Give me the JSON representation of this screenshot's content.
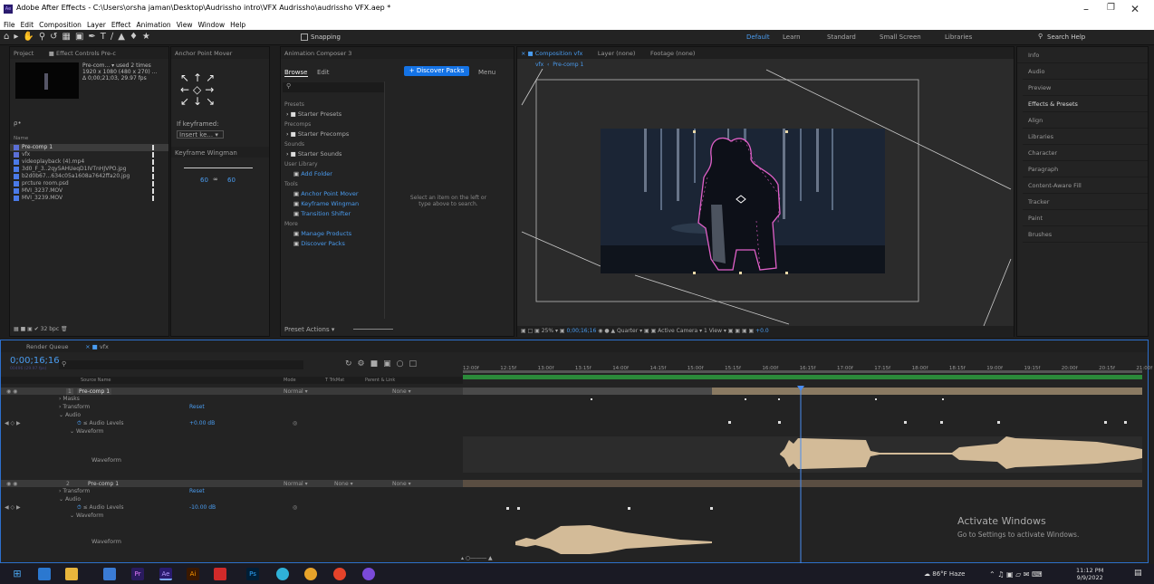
{
  "app": {
    "title": "Adobe After Effects - C:\\Users\\orsha jaman\\Desktop\\Audrissho intro\\VFX Audrissho\\audrissho VFX.aep *",
    "menus": [
      "File",
      "Edit",
      "Composition",
      "Layer",
      "Effect",
      "Animation",
      "View",
      "Window",
      "Help"
    ]
  },
  "toolbar": {
    "snapping": "Snapping",
    "workspaces": [
      "Default",
      "Learn",
      "Standard",
      "Small Screen",
      "Libraries"
    ],
    "search": "Search Help"
  },
  "project": {
    "tabs": [
      "Project",
      "Effect Controls Pre-c"
    ],
    "item_name": "Pre-com... ▾ used 2 times",
    "item_info": "1920 x 1080 (480 x 270) ...",
    "item_dur": "Δ 0;00;21;03, 29.97 fps",
    "search_ph": "ρ•",
    "col_name": "Name",
    "files": [
      "Pre-comp 1",
      "vfx",
      "videoplayback (4).mp4",
      "3d0_F_3..2qy5AHUeqD1IVTnHJVPO.jpg",
      "b2d0b67...634c05a1608a7642ffa20.jpg",
      "prcture room.psd",
      "MVI_3237.MOV",
      "MVI_3239.MOV"
    ],
    "bpc": "32 bpc"
  },
  "anchor": {
    "title": "Anchor Point Mover",
    "if_kf": "If keyframed:",
    "insert": "Insert ke...",
    "kw_title": "Keyframe Wingman",
    "kw_l": "60",
    "kw_r": "60"
  },
  "composer": {
    "title": "Animation Composer 3",
    "browse": "Browse",
    "edit": "Edit",
    "discover": "+ Discover Packs",
    "menu": "Menu",
    "presets": "Presets",
    "starter_presets": "Starter Presets",
    "precomps": "Precomps",
    "starter_precomps": "Starter Precomps",
    "sounds": "Sounds",
    "starter_sounds": "Starter Sounds",
    "user_library": "User Library",
    "add_folder": "Add Folder",
    "tools": "Tools",
    "apm": "Anchor Point Mover",
    "kw": "Keyframe Wingman",
    "ts": "Transition Shifter",
    "more": "More",
    "manage": "Manage Products",
    "discover2": "Discover Packs",
    "hint": "Select an item on the left or type above to search.",
    "preset_actions": "Preset Actions"
  },
  "viewer": {
    "tab_comp": "Composition vfx",
    "tab_layer": "Layer (none)",
    "tab_footage": "Footage (none)",
    "crumb1": "vfx",
    "crumb2": "Pre-comp 1",
    "zoom": "25%",
    "time": "0;00;16;16",
    "res": "Quarter",
    "camera": "Active Camera",
    "view": "1 View",
    "exposure": "+0.0"
  },
  "right": [
    "Info",
    "Audio",
    "Preview",
    "Effects & Presets",
    "Align",
    "Libraries",
    "Character",
    "Paragraph",
    "Content-Aware Fill",
    "Tracker",
    "Paint",
    "Brushes"
  ],
  "timeline": {
    "tab_rq": "Render Queue",
    "tab_vfx": "vfx",
    "timecode": "0;00;16;16",
    "fps": "00496 (29.97 fps)",
    "ruler": [
      "12:00f",
      "12:15f",
      "13:00f",
      "13:15f",
      "14:00f",
      "14:15f",
      "15:00f",
      "15:15f",
      "16:00f",
      "16:15f",
      "17:00f",
      "17:15f",
      "18:00f",
      "18:15f",
      "19:00f",
      "19:15f",
      "20:00f",
      "20:15f",
      "21:00f"
    ],
    "cols": {
      "source": "Source Name",
      "mode": "Mode",
      "trkmat": "T TrkMat",
      "parent": "Parent & Link"
    },
    "l1": {
      "num": "1",
      "name": "Pre-comp 1",
      "mode": "Normal",
      "parent": "None"
    },
    "masks": "Masks",
    "transform": "Transform",
    "reset": "Reset",
    "audio": "Audio",
    "audio_levels": "Audio Levels",
    "l1_db": "+0.00 dB",
    "waveform": "Waveform",
    "l2": {
      "num": "2",
      "name": "Pre-comp 1",
      "mode": "Normal",
      "trk": "None",
      "parent": "None"
    },
    "l2_db": "-10.00 dB"
  },
  "activate": {
    "title": "Activate Windows",
    "sub": "Go to Settings to activate Windows."
  },
  "taskbar": {
    "weather": "86°F Haze",
    "time": "11:12 PM",
    "date": "9/9/2022"
  }
}
